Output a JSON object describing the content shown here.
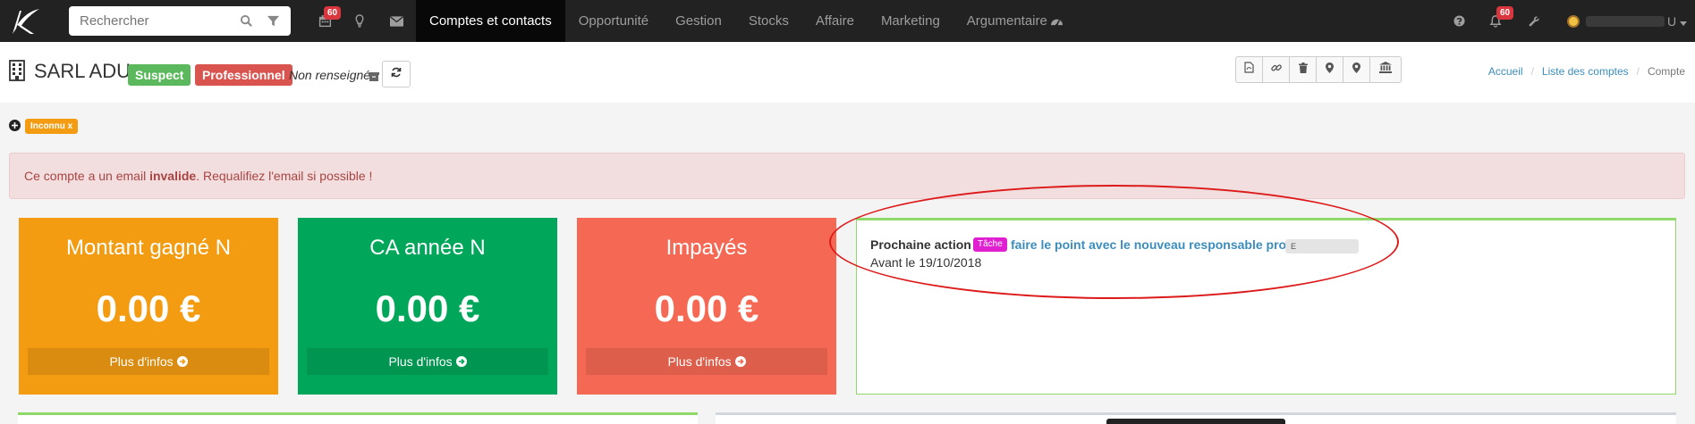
{
  "search": {
    "placeholder": "Rechercher"
  },
  "topbar": {
    "calendar_badge": "60",
    "notif_badge": "60",
    "user_initial": "U"
  },
  "menu": [
    {
      "label": "Comptes et contacts",
      "active": true
    },
    {
      "label": "Opportunité"
    },
    {
      "label": "Gestion"
    },
    {
      "label": "Stocks"
    },
    {
      "label": "Affaire"
    },
    {
      "label": "Marketing"
    },
    {
      "label": "Argumentaire"
    }
  ],
  "account": {
    "name": "SARL ADU",
    "status_label": "Suspect",
    "type_label": "Professionnel",
    "info": "Non renseigné"
  },
  "breadcrumb": {
    "home": "Accueil",
    "list": "Liste des comptes",
    "current": "Compte"
  },
  "tag": {
    "label": "Inconnu x"
  },
  "alert": {
    "before": "Ce compte a un email ",
    "bold": "invalide",
    "after": ". Requalifiez l'email si possible !"
  },
  "boxes": [
    {
      "title": "Montant gagné N",
      "value": "0.00 €",
      "more": "Plus d'infos"
    },
    {
      "title": "CA année N",
      "value": "0.00 €",
      "more": "Plus d'infos"
    },
    {
      "title": "Impayés",
      "value": "0.00 €",
      "more": "Plus d'infos"
    }
  ],
  "next_action": {
    "label": "Prochaine action :",
    "type": "Tâche",
    "text": "faire le point avec le nouveau responsable projet",
    "owner": "E",
    "deadline": "Avant le 19/10/2018"
  },
  "colors": {
    "orange": "#f39c12",
    "green": "#00a65a",
    "salmon": "#f56954",
    "nav": "#222222",
    "accent": "#3c8dbc"
  }
}
